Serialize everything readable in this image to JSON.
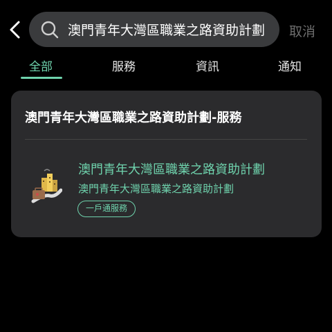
{
  "header": {
    "back_icon": "chevron-left-icon",
    "search_icon": "search-icon",
    "search_value": "澳門青年大灣區職業之路資助計劃",
    "cancel_label": "取消"
  },
  "tabs": [
    {
      "label": "全部",
      "active": true
    },
    {
      "label": "服務",
      "active": false
    },
    {
      "label": "資訊",
      "active": false
    },
    {
      "label": "通知",
      "active": false
    }
  ],
  "colors": {
    "accent": "#6fd3ad",
    "card_bg": "#2b2b2d",
    "search_bg": "#3a3b3d"
  },
  "results": {
    "section_title": "澳門青年大灣區職業之路資助計劃-服務",
    "items": [
      {
        "icon": "city-road-suitcase-icon",
        "title": "澳門青年大灣區職業之路資助計劃",
        "subtitle": "澳門青年大灣區職業之路資助計劃",
        "tag": "一戶通服務"
      }
    ]
  }
}
